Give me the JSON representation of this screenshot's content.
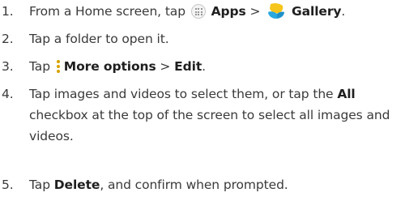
{
  "steps": [
    {
      "number": "1.",
      "text_a": "From a Home screen, tap",
      "apps_label": "Apps",
      "separator": ">",
      "gallery_label": "Gallery",
      "end": "."
    },
    {
      "number": "2.",
      "text": "Tap a folder to open it."
    },
    {
      "number": "3.",
      "text_a": "Tap",
      "more_label": "More options",
      "separator": ">",
      "edit_label": "Edit",
      "end": "."
    },
    {
      "number": "4.",
      "text_a": "Tap images and videos to select them, or tap the",
      "all_label": "All",
      "text_b": "checkbox at the top of the screen to select all images and videos."
    },
    {
      "number": "5.",
      "text_a": "Tap",
      "delete_label": "Delete",
      "text_b": ", and confirm when prompted."
    }
  ],
  "icons": {
    "apps": "apps-grid-icon",
    "gallery": "gallery-icon",
    "more": "more-options-icon"
  },
  "colors": {
    "text": "#3a3a3a",
    "bold_text": "#1f1f1f",
    "more_options_dots": "#d8a200",
    "gallery_yellow": "#f6c51b",
    "gallery_blue": "#2aa8e0"
  }
}
